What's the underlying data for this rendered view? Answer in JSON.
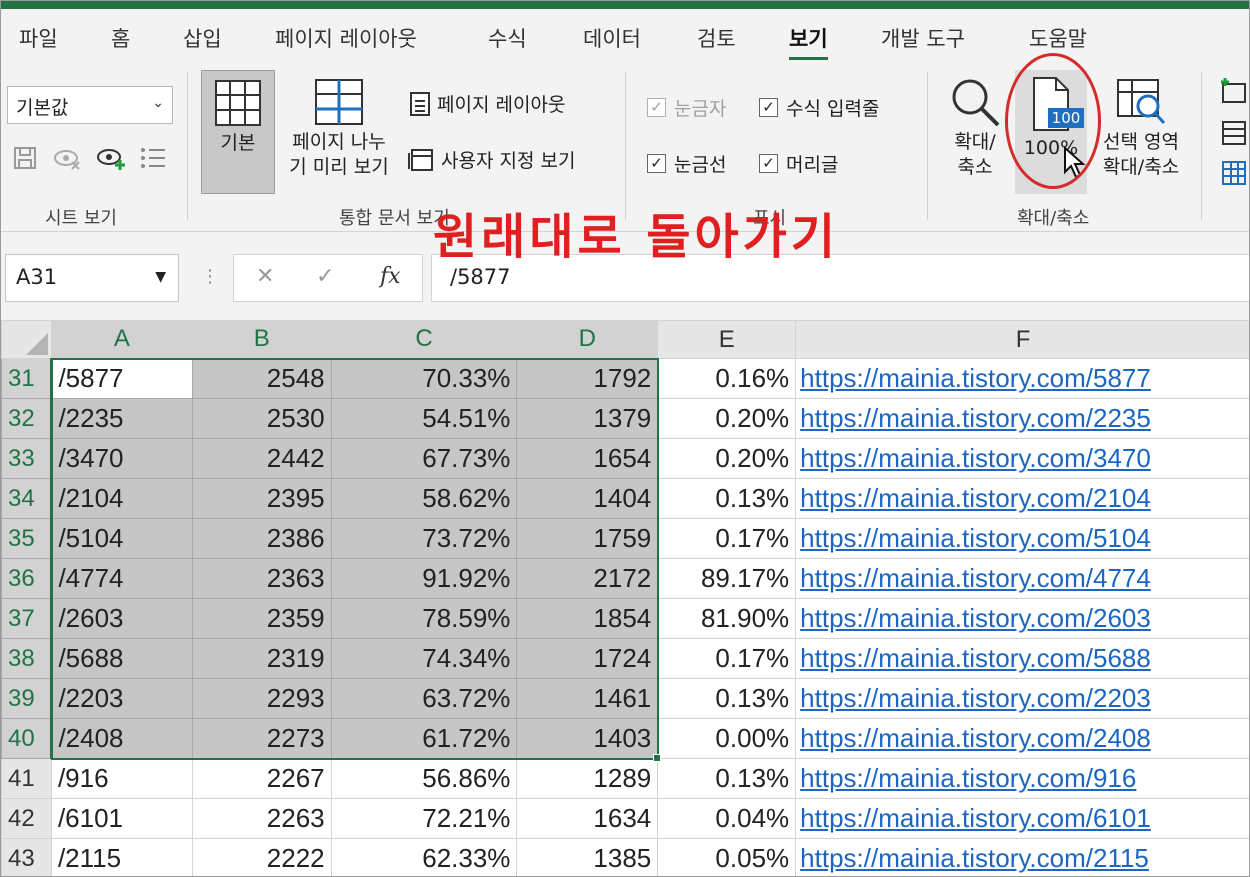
{
  "tabs": [
    "파일",
    "홈",
    "삽입",
    "페이지 레이아웃",
    "수식",
    "데이터",
    "검토",
    "보기",
    "개발 도구",
    "도움말"
  ],
  "active_tab": "보기",
  "ribbon": {
    "sheet_view": {
      "dropdown_value": "기본값",
      "label": "시트 보기"
    },
    "workbook_views": {
      "normal": "기본",
      "page_break_line1": "페이지 나누",
      "page_break_line2": "기 미리 보기",
      "page_layout": "페이지 레이아웃",
      "custom_views": "사용자 지정 보기",
      "label": "통합 문서 보기"
    },
    "show": {
      "ruler": "눈금자",
      "formula_bar": "수식 입력줄",
      "gridlines": "눈금선",
      "headings": "머리글",
      "label": "표시"
    },
    "zoom": {
      "zoom_line1": "확대/",
      "zoom_line2": "축소",
      "hundred": "100%",
      "hundred_icon_text": "100",
      "selection_line1": "선택 영역",
      "selection_line2": "확대/축소",
      "label": "확대/축소"
    }
  },
  "annotation": "원래대로 돌아가기",
  "formula_bar": {
    "name_box": "A31",
    "cancel": "✕",
    "enter": "✓",
    "fx": "fx",
    "content": "/5877"
  },
  "columns": [
    "A",
    "B",
    "C",
    "D",
    "E",
    "F"
  ],
  "rows": [
    {
      "num": "31",
      "a": "/5877",
      "b": "2548",
      "c": "70.33%",
      "d": "1792",
      "e": "0.16%",
      "f": "https://mainia.tistory.com/5877"
    },
    {
      "num": "32",
      "a": "/2235",
      "b": "2530",
      "c": "54.51%",
      "d": "1379",
      "e": "0.20%",
      "f": "https://mainia.tistory.com/2235"
    },
    {
      "num": "33",
      "a": "/3470",
      "b": "2442",
      "c": "67.73%",
      "d": "1654",
      "e": "0.20%",
      "f": "https://mainia.tistory.com/3470"
    },
    {
      "num": "34",
      "a": "/2104",
      "b": "2395",
      "c": "58.62%",
      "d": "1404",
      "e": "0.13%",
      "f": "https://mainia.tistory.com/2104"
    },
    {
      "num": "35",
      "a": "/5104",
      "b": "2386",
      "c": "73.72%",
      "d": "1759",
      "e": "0.17%",
      "f": "https://mainia.tistory.com/5104"
    },
    {
      "num": "36",
      "a": "/4774",
      "b": "2363",
      "c": "91.92%",
      "d": "2172",
      "e": "89.17%",
      "f": "https://mainia.tistory.com/4774"
    },
    {
      "num": "37",
      "a": "/2603",
      "b": "2359",
      "c": "78.59%",
      "d": "1854",
      "e": "81.90%",
      "f": "https://mainia.tistory.com/2603"
    },
    {
      "num": "38",
      "a": "/5688",
      "b": "2319",
      "c": "74.34%",
      "d": "1724",
      "e": "0.17%",
      "f": "https://mainia.tistory.com/5688"
    },
    {
      "num": "39",
      "a": "/2203",
      "b": "2293",
      "c": "63.72%",
      "d": "1461",
      "e": "0.13%",
      "f": "https://mainia.tistory.com/2203"
    },
    {
      "num": "40",
      "a": "/2408",
      "b": "2273",
      "c": "61.72%",
      "d": "1403",
      "e": "0.00%",
      "f": "https://mainia.tistory.com/2408"
    },
    {
      "num": "41",
      "a": "/916",
      "b": "2267",
      "c": "56.86%",
      "d": "1289",
      "e": "0.13%",
      "f": "https://mainia.tistory.com/916"
    },
    {
      "num": "42",
      "a": "/6101",
      "b": "2263",
      "c": "72.21%",
      "d": "1634",
      "e": "0.04%",
      "f": "https://mainia.tistory.com/6101"
    },
    {
      "num": "43",
      "a": "/2115",
      "b": "2222",
      "c": "62.33%",
      "d": "1385",
      "e": "0.05%",
      "f": "https://mainia.tistory.com/2115"
    }
  ],
  "selection": {
    "range": "A31:D40",
    "selected_rows": 10,
    "selected_columns": [
      "A",
      "B",
      "C",
      "D"
    ]
  },
  "colors": {
    "accent": "#217346",
    "annotation": "#e02020",
    "link": "#1a66c2"
  }
}
